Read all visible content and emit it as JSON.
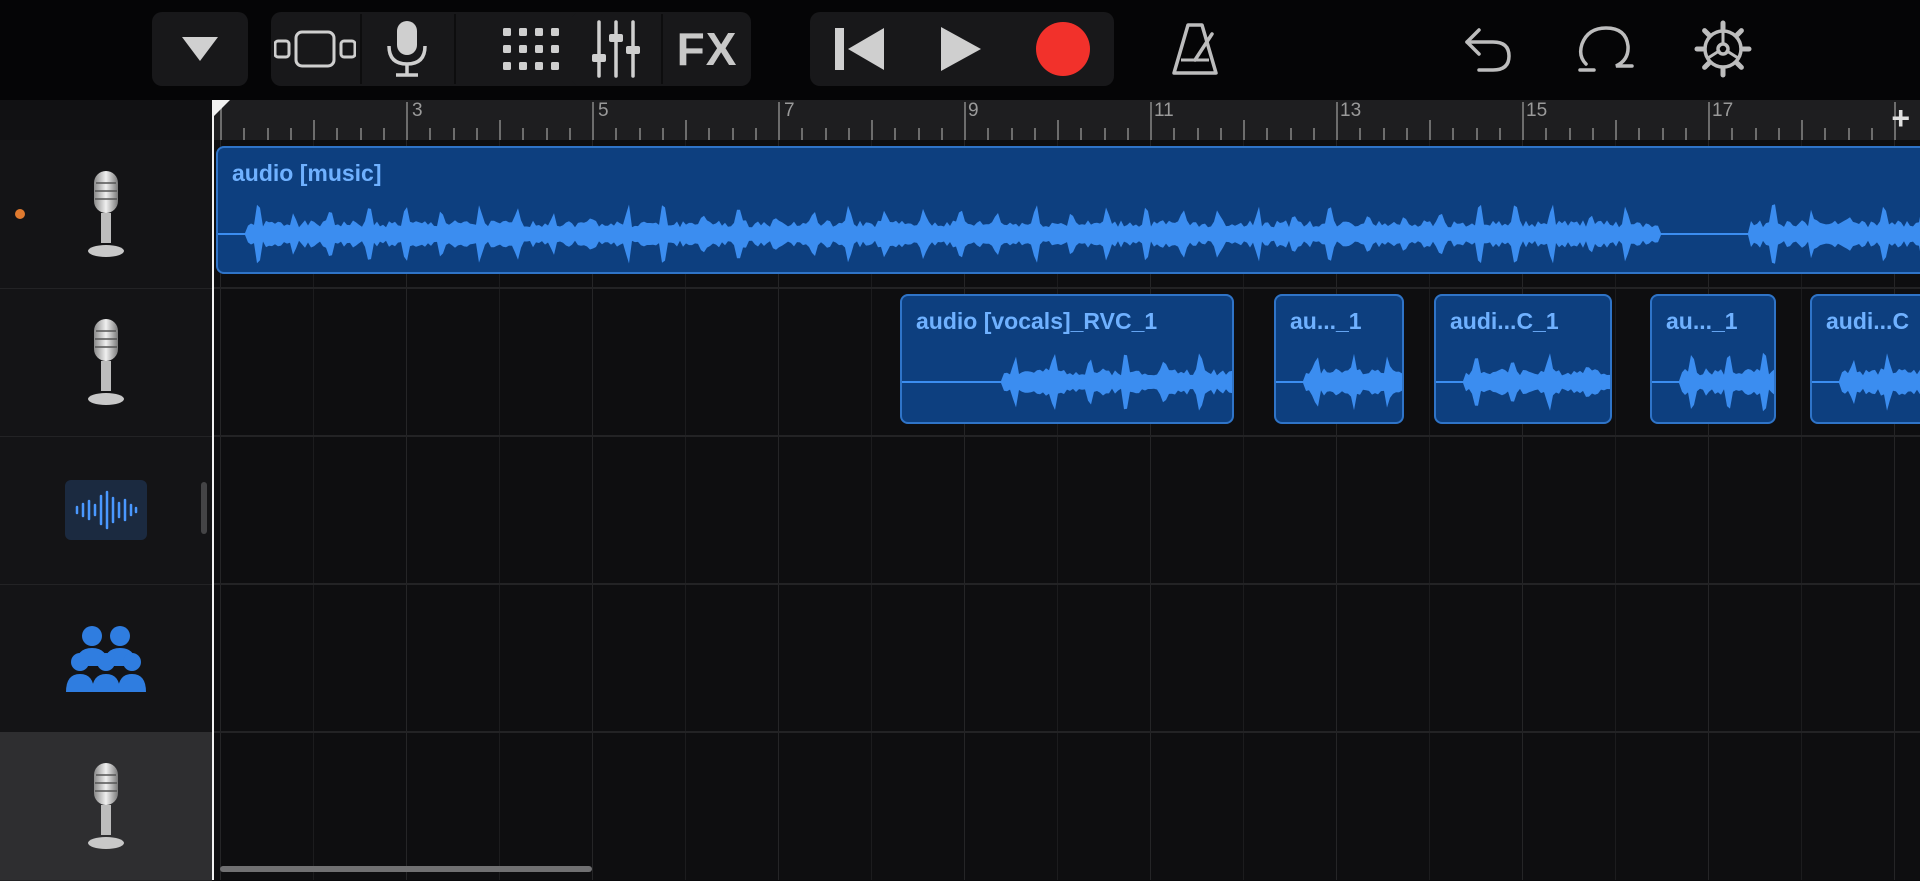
{
  "toolbar": {
    "fx_label": "FX"
  },
  "ruler": {
    "bar_numbers": [
      "3",
      "5",
      "7",
      "9",
      "11",
      "13",
      "15",
      "17"
    ],
    "add_label": "+"
  },
  "tracks": [
    {
      "icon": "microphone-icon",
      "selected": false,
      "has_indicator": true
    },
    {
      "icon": "microphone-icon",
      "selected": false,
      "has_indicator": false
    },
    {
      "icon": "waveform-icon",
      "selected": false,
      "has_indicator": false
    },
    {
      "icon": "people-icon",
      "selected": false,
      "has_indicator": false
    },
    {
      "icon": "microphone-icon",
      "selected": true,
      "has_indicator": false
    }
  ],
  "regions": [
    {
      "track": 0,
      "name": "audio [music]"
    },
    {
      "track": 1,
      "name": "audio [vocals]_RVC_1"
    },
    {
      "track": 1,
      "name": "au..._1"
    },
    {
      "track": 1,
      "name": "audi...C_1"
    },
    {
      "track": 1,
      "name": "au..._1"
    },
    {
      "track": 1,
      "name": "audi...C"
    }
  ],
  "colors": {
    "region_fill": "#0d3f7f",
    "region_border": "#2f74c8",
    "region_text": "#6fb1ff",
    "record": "#f2312b",
    "track_indicator": "#e07a2f"
  }
}
